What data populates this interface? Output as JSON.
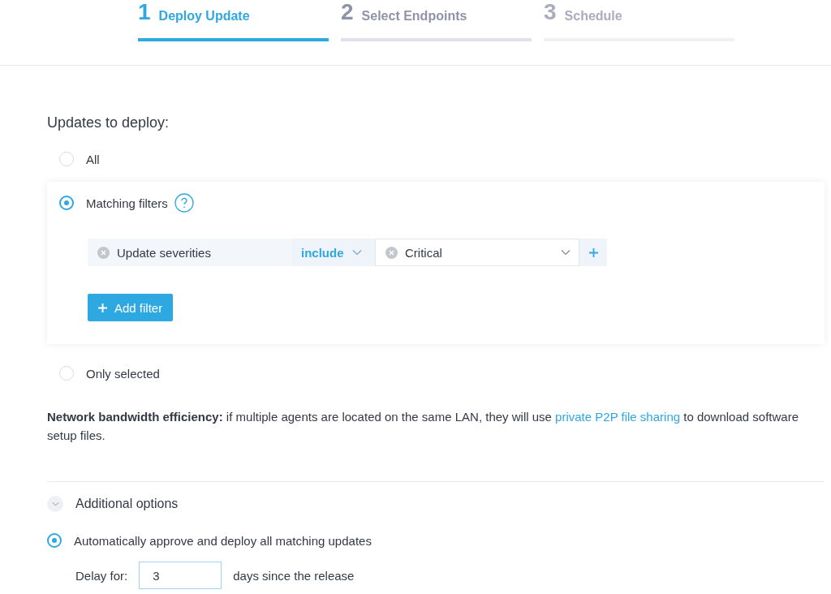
{
  "steps": [
    {
      "number": "1",
      "label": "Deploy Update",
      "selected": true,
      "disabled": false
    },
    {
      "number": "2",
      "label": "Select Endpoints",
      "selected": false,
      "disabled": false
    },
    {
      "number": "3",
      "label": "Schedule",
      "selected": false,
      "disabled": true
    }
  ],
  "updates": {
    "heading": "Updates to deploy:",
    "options": [
      {
        "label": "All",
        "selected": false
      },
      {
        "label": "Matching filters",
        "selected": true,
        "filters": [
          {
            "field": "Update severities",
            "operator": "include",
            "value": "Critical"
          }
        ],
        "add_button": "Add filter"
      },
      {
        "label": "Only selected",
        "selected": false
      }
    ]
  },
  "bandwidth_note": {
    "text": "**Network bandwidth efficiency:** if multiple agents are located on the same LAN, they will use",
    "link": "private P2P file sharing",
    "rest": "to download software setup files."
  },
  "additional_options": {
    "title": "Additional options",
    "expanded": true,
    "auto_approve": {
      "label": "Automatically approve and deploy all matching updates",
      "selected": true
    },
    "delay": {
      "label": "Delay for:",
      "value": "3",
      "suffix": "days since the release"
    }
  }
}
